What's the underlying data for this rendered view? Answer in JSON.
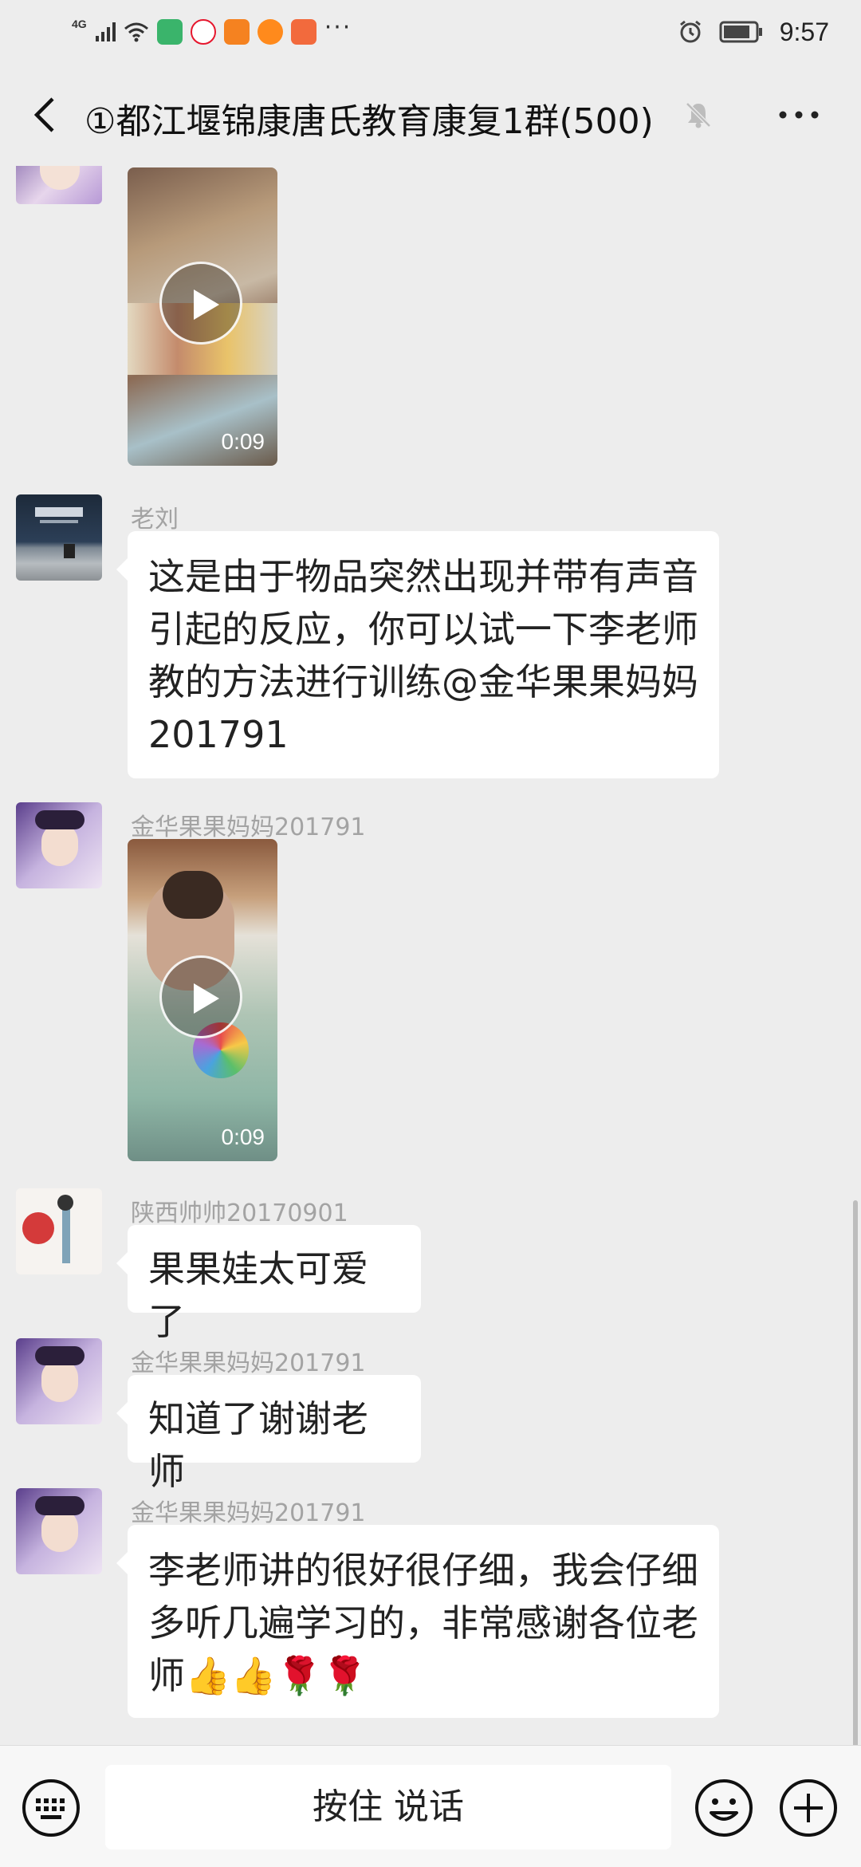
{
  "status_bar": {
    "network": "4G",
    "time": "9:57",
    "overflow": "···"
  },
  "header": {
    "title": "①都江堰锦康唐氏教育康复1群(500)"
  },
  "messages": [
    {
      "type": "video",
      "sender": "",
      "duration": "0:09"
    },
    {
      "type": "text",
      "sender": "老刘",
      "lines": [
        "这是由于物品突然出现并带有声音",
        "引起的反应，你可以试一下李老师",
        "教的方法进行训练@金华果果妈妈",
        "201791"
      ]
    },
    {
      "type": "video",
      "sender": "金华果果妈妈201791",
      "duration": "0:09"
    },
    {
      "type": "text",
      "sender": "陕西帅帅20170901",
      "lines": [
        "果果娃太可爱了"
      ]
    },
    {
      "type": "text",
      "sender": "金华果果妈妈201791",
      "lines": [
        "知道了谢谢老师"
      ]
    },
    {
      "type": "text",
      "sender": "金华果果妈妈201791",
      "lines": [
        "李老师讲的很好很仔细，我会仔细",
        "多听几遍学习的，非常感谢各位老",
        "师👍👍🌹🌹"
      ]
    }
  ],
  "input": {
    "hold_to_talk": "按住 说话"
  },
  "icons": {
    "back": "back-arrow-icon",
    "mute": "mute-bell-icon",
    "more": "more-dots-icon",
    "keyboard": "keyboard-icon",
    "emoji": "emoji-icon",
    "plus": "plus-icon"
  }
}
